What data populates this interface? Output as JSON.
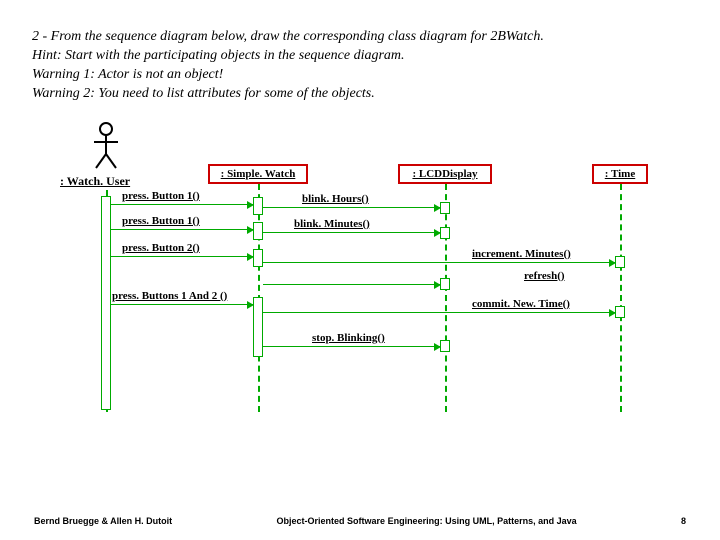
{
  "question": {
    "line1": "2 - From the sequence diagram below, draw the corresponding class diagram for 2BWatch.",
    "line2": "Hint: Start with the participating objects in the sequence diagram.",
    "line3": "Warning 1: Actor is not an object!",
    "line4": "Warning 2: You need to list attributes for some of the objects."
  },
  "actor": {
    "label": ": Watch. User"
  },
  "lifelines": {
    "simpleWatch": ": Simple. Watch",
    "lcdDisplay": ": LCDDisplay",
    "time": ": Time"
  },
  "messages": {
    "m1": "press. Button 1()",
    "m2": "press. Button 1()",
    "m3": "press. Button 2()",
    "m4": "press. Buttons 1 And 2 ()",
    "m5": "blink. Hours()",
    "m6": "blink. Minutes()",
    "m7": "increment. Minutes()",
    "m8": "refresh()",
    "m9": "commit. New. Time()",
    "m10": "stop. Blinking()"
  },
  "footer": {
    "left": "Bernd Bruegge & Allen H. Dutoit",
    "center": "Object-Oriented Software Engineering: Using UML, Patterns, and Java",
    "right": "8"
  }
}
